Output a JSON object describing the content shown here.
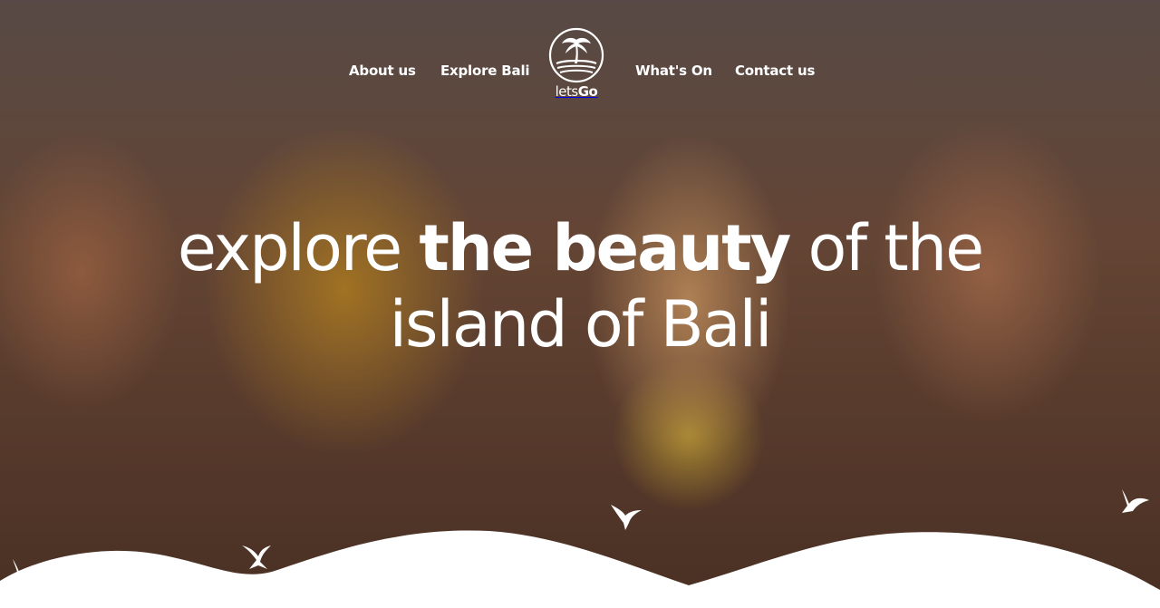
{
  "nav": {
    "links": [
      {
        "label": "About us"
      },
      {
        "label": "Explore Bali"
      },
      {
        "label": "What's On"
      },
      {
        "label": "Contact us"
      }
    ],
    "logo": {
      "prefix": "lets",
      "suffix": "Go",
      "icon": "palm-tree-island-icon"
    }
  },
  "hero": {
    "headline": {
      "part1": "explore ",
      "part2": "the beauty",
      "part3": " of the",
      "line2": "island of Bali"
    }
  },
  "decor": {
    "bird_icon": "bird-icon",
    "wave_color": "#ffffff"
  }
}
